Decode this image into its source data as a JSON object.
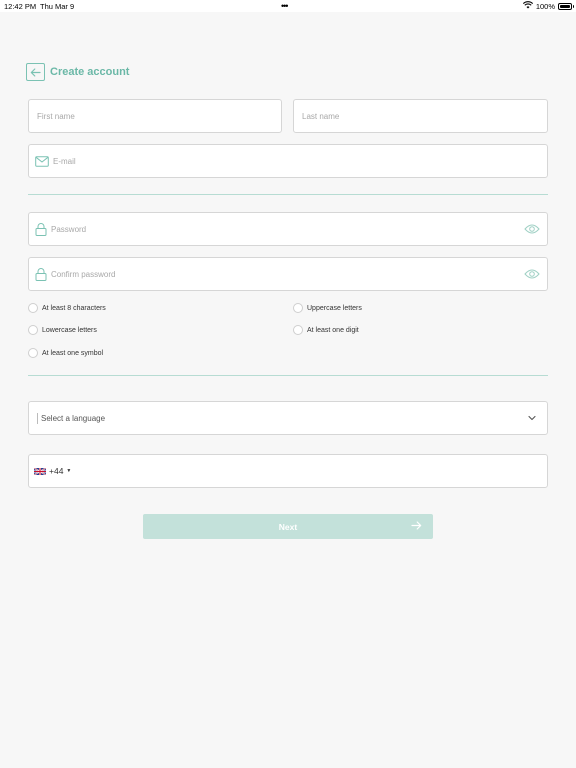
{
  "status_bar": {
    "time": "12:42 PM",
    "date": "Thu Mar 9",
    "dots": "•••",
    "battery": "100%"
  },
  "header": {
    "title": "Create account",
    "back_icon": "arrow-left-icon"
  },
  "form": {
    "first_name_placeholder": "First name",
    "last_name_placeholder": "Last name",
    "email_placeholder": "E-mail",
    "password_placeholder": "Password",
    "confirm_password_placeholder": "Confirm password",
    "requirements": [
      "At least 8 characters",
      "Uppercase letters",
      "Lowercase letters",
      "At least one digit",
      "At least one symbol"
    ],
    "language_placeholder": "Select a language",
    "phone_code": "+44",
    "next_label": "Next"
  },
  "colors": {
    "accent": "#6bb8a7",
    "button_disabled": "#c3e1da",
    "divider": "#b7dcd3",
    "background": "#f7f7f7"
  }
}
